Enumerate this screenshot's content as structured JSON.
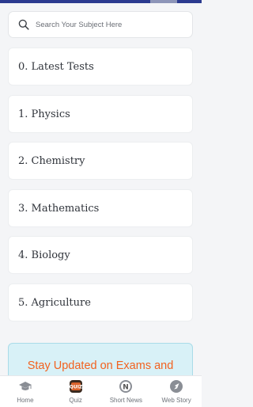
{
  "search": {
    "placeholder": "Search Your Subject Here"
  },
  "subjects": [
    {
      "label": "0. Latest Tests"
    },
    {
      "label": "1. Physics"
    },
    {
      "label": "2. Chemistry"
    },
    {
      "label": "3. Mathematics"
    },
    {
      "label": "4. Biology"
    },
    {
      "label": "5. Agriculture"
    }
  ],
  "banner": {
    "text": "Stay Updated on Exams and"
  },
  "bottom_nav": [
    {
      "label": "Home",
      "icon": "graduation-cap-icon"
    },
    {
      "label": "Quiz",
      "icon": "quiz-icon"
    },
    {
      "label": "Short News",
      "icon": "news-icon"
    },
    {
      "label": "Web Story",
      "icon": "web-story-icon"
    }
  ],
  "colors": {
    "accent": "#f2621f",
    "banner_bg": "#d8f1f7",
    "header": "#2b3a8f"
  }
}
